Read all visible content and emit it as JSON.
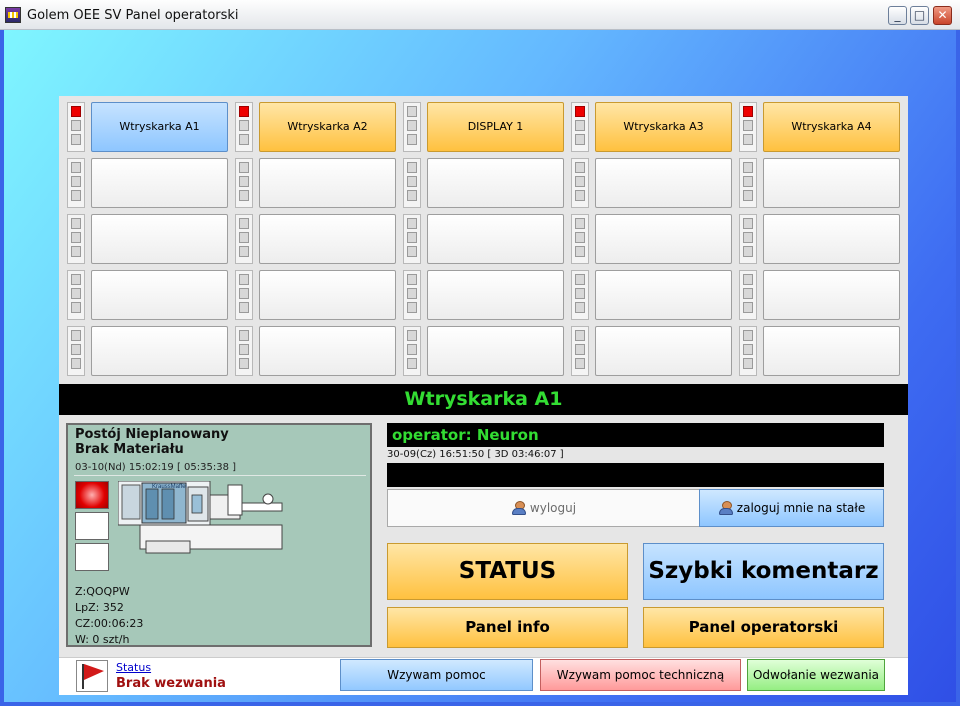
{
  "window": {
    "title": "Golem OEE SV  Panel operatorski",
    "minimize_glyph": "_",
    "maximize_glyph": "□",
    "close_glyph": "✕"
  },
  "colors": {
    "orange_button": "#ffc13f",
    "blue_button": "#8ec6ff",
    "indicator_red": "#ee0000",
    "machine_name_text": "#33dd33",
    "info_box_bg": "#a6c8b9"
  },
  "grid": [
    [
      {
        "label": "Wtryskarka A1",
        "style": "blue",
        "lamps": [
          "red",
          "off",
          "off"
        ]
      },
      {
        "label": "Wtryskarka A2",
        "style": "orange",
        "lamps": [
          "red",
          "off",
          "off"
        ]
      },
      {
        "label": "DISPLAY 1",
        "style": "orange",
        "lamps": [
          "off",
          "off",
          "off"
        ]
      },
      {
        "label": "Wtryskarka A3",
        "style": "orange",
        "lamps": [
          "red",
          "off",
          "off"
        ]
      },
      {
        "label": "Wtryskarka A4",
        "style": "orange",
        "lamps": [
          "red",
          "off",
          "off"
        ]
      }
    ],
    [
      {
        "label": "",
        "style": "empty",
        "lamps": [
          "off",
          "off",
          "off"
        ]
      },
      {
        "label": "",
        "style": "empty",
        "lamps": [
          "off",
          "off",
          "off"
        ]
      },
      {
        "label": "",
        "style": "empty",
        "lamps": [
          "off",
          "off",
          "off"
        ]
      },
      {
        "label": "",
        "style": "empty",
        "lamps": [
          "off",
          "off",
          "off"
        ]
      },
      {
        "label": "",
        "style": "empty",
        "lamps": [
          "off",
          "off",
          "off"
        ]
      }
    ],
    [
      {
        "label": "",
        "style": "empty",
        "lamps": [
          "off",
          "off",
          "off"
        ]
      },
      {
        "label": "",
        "style": "empty",
        "lamps": [
          "off",
          "off",
          "off"
        ]
      },
      {
        "label": "",
        "style": "empty",
        "lamps": [
          "off",
          "off",
          "off"
        ]
      },
      {
        "label": "",
        "style": "empty",
        "lamps": [
          "off",
          "off",
          "off"
        ]
      },
      {
        "label": "",
        "style": "empty",
        "lamps": [
          "off",
          "off",
          "off"
        ]
      }
    ],
    [
      {
        "label": "",
        "style": "empty",
        "lamps": [
          "off",
          "off",
          "off"
        ]
      },
      {
        "label": "",
        "style": "empty",
        "lamps": [
          "off",
          "off",
          "off"
        ]
      },
      {
        "label": "",
        "style": "empty",
        "lamps": [
          "off",
          "off",
          "off"
        ]
      },
      {
        "label": "",
        "style": "empty",
        "lamps": [
          "off",
          "off",
          "off"
        ]
      },
      {
        "label": "",
        "style": "empty",
        "lamps": [
          "off",
          "off",
          "off"
        ]
      }
    ],
    [
      {
        "label": "",
        "style": "empty",
        "lamps": [
          "off",
          "off",
          "off"
        ]
      },
      {
        "label": "",
        "style": "empty",
        "lamps": [
          "off",
          "off",
          "off"
        ]
      },
      {
        "label": "",
        "style": "empty",
        "lamps": [
          "off",
          "off",
          "off"
        ]
      },
      {
        "label": "",
        "style": "empty",
        "lamps": [
          "off",
          "off",
          "off"
        ]
      },
      {
        "label": "",
        "style": "empty",
        "lamps": [
          "off",
          "off",
          "off"
        ]
      }
    ]
  ],
  "machine": {
    "name": "Wtryskarka A1",
    "status_title_1": "Postój Nieplanowany",
    "status_title_2": "Brak Materiału",
    "status_datetime": "03-10(Nd) 15:02:19  [ 05:35:38 ]",
    "signal_tower": [
      "red",
      "off",
      "off"
    ],
    "image_brand": "KraussMaffei",
    "stats": {
      "z": "Z:QOQPW",
      "lpz": "LpZ: 352",
      "cz": "CZ:00:06:23",
      "w": "W: 0 szt/h"
    }
  },
  "operator": {
    "line": "operator: Neuron",
    "since": "30-09(Cz) 16:51:50  [ 3D 03:46:07 ]",
    "logout_label": "wyloguj",
    "login_label": "zaloguj mnie na stałe"
  },
  "actions": {
    "status": "STATUS",
    "quick_comment": "Szybki komentarz",
    "panel_info": "Panel info",
    "panel_operator": "Panel operatorski"
  },
  "footer": {
    "status_link": "Status",
    "status_text": "Brak wezwania",
    "help": "Wzywam pomoc",
    "help_tech": "Wzywam pomoc techniczną",
    "cancel_call": "Odwołanie wezwania"
  }
}
